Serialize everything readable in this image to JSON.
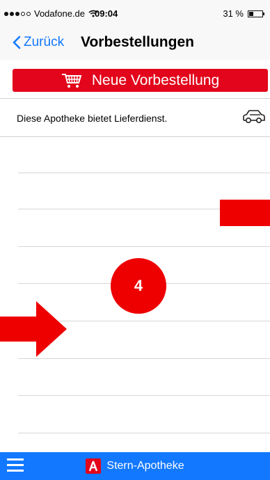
{
  "status_bar": {
    "carrier": "Vodafone.de",
    "time": "09:04",
    "battery": "31 %",
    "battery_level": 0.31
  },
  "nav": {
    "back_label": "Zurück",
    "title": "Vorbestellungen"
  },
  "order_button": {
    "label": "Neue Vorbestellung",
    "icon": "shopping-cart-icon",
    "color": "#e2051b"
  },
  "delivery": {
    "text": "Diese Apotheke bietet Lieferdienst.",
    "icon": "car-icon"
  },
  "annotation": {
    "badge_number": "4",
    "color": "#ee0000"
  },
  "tab_bar": {
    "pharmacy_name": "Stern-Apotheke",
    "color": "#1278ff"
  }
}
